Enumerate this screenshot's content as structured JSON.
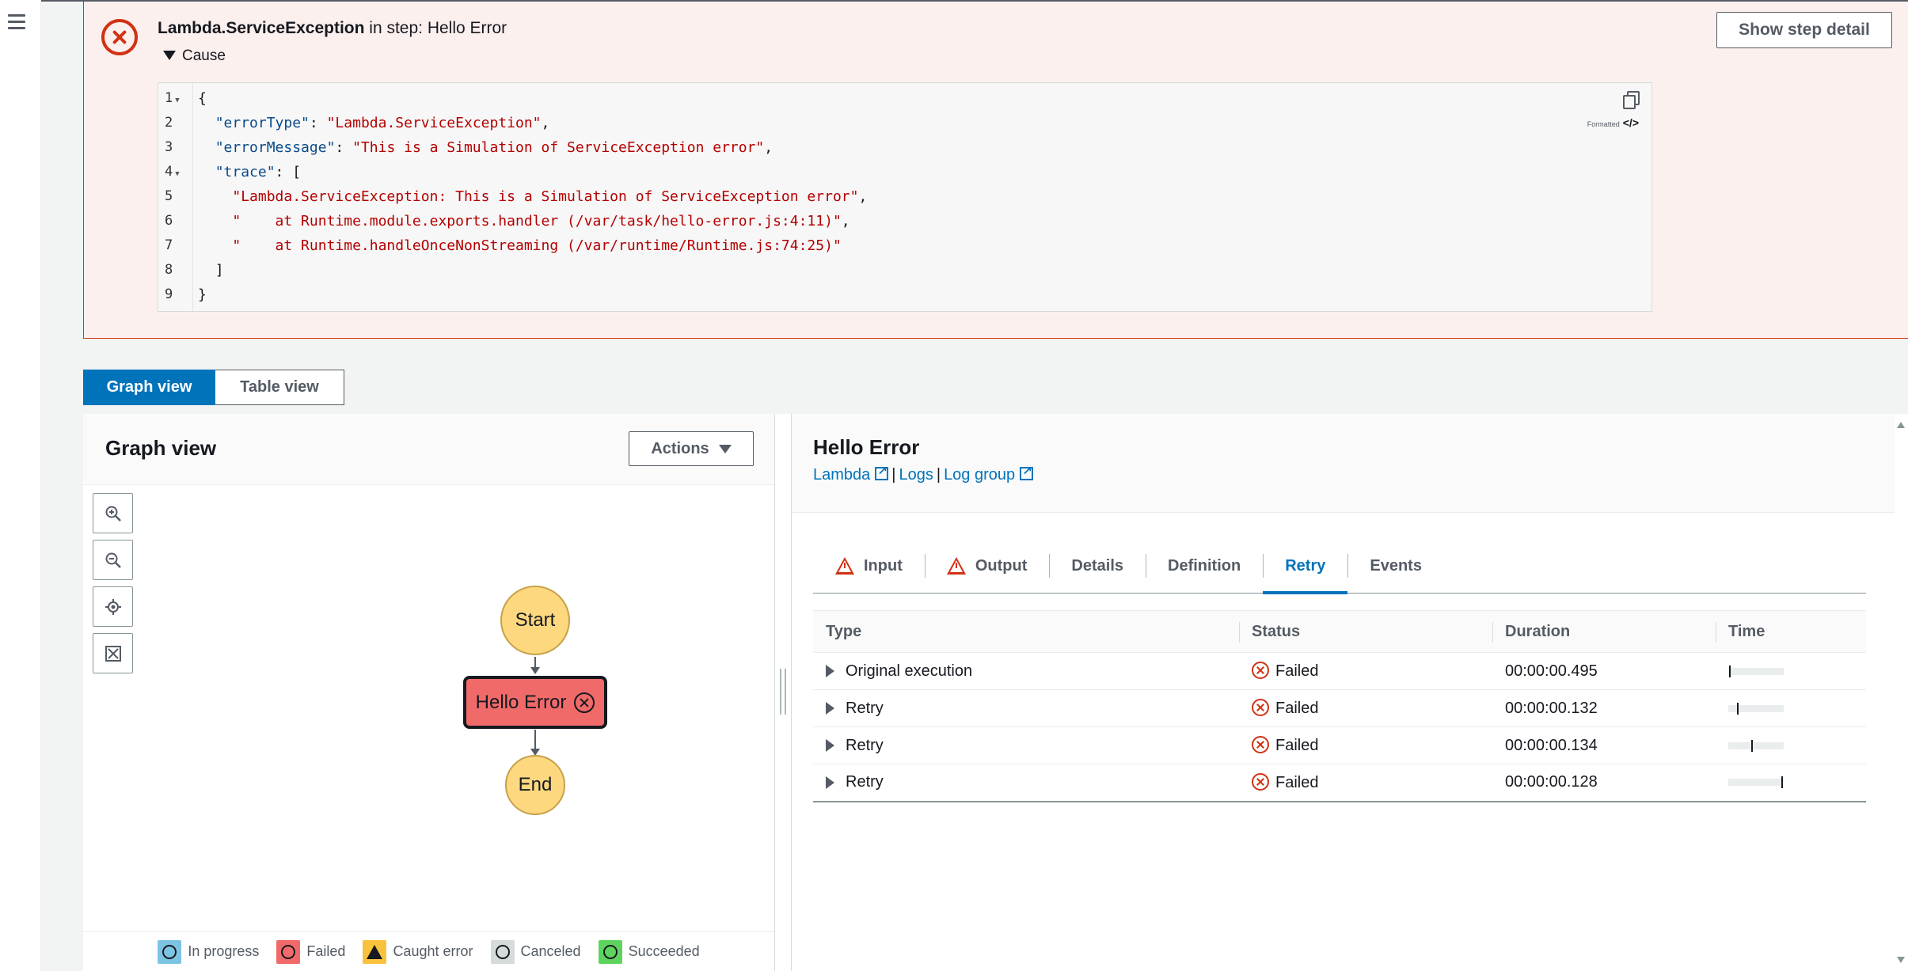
{
  "error": {
    "type": "Lambda.ServiceException",
    "suffix": " in step: Hello Error",
    "cause_label": "Cause",
    "show_step_button": "Show step detail",
    "format_label": "Formatted",
    "code_lines": [
      {
        "n": "1",
        "fold": true
      },
      {
        "n": "2"
      },
      {
        "n": "3"
      },
      {
        "n": "4",
        "fold": true
      },
      {
        "n": "5"
      },
      {
        "n": "6"
      },
      {
        "n": "7"
      },
      {
        "n": "8"
      },
      {
        "n": "9"
      }
    ],
    "json": {
      "open": "{",
      "k_type": "\"errorType\"",
      "v_type": "\"Lambda.ServiceException\"",
      "k_msg": "\"errorMessage\"",
      "v_msg": "\"This is a Simulation of ServiceException error\"",
      "k_trace": "\"trace\"",
      "t1": "\"Lambda.ServiceException: This is a Simulation of ServiceException error\"",
      "t2": "\"    at Runtime.module.exports.handler (/var/task/hello-error.js:4:11)\"",
      "t3": "\"    at Runtime.handleOnceNonStreaming (/var/runtime/Runtime.js:74:25)\"",
      "close_arr": "]",
      "close": "}"
    }
  },
  "view_toggle": {
    "graph": "Graph view",
    "table": "Table view",
    "selected": "graph"
  },
  "graph": {
    "title": "Graph view",
    "actions": "Actions",
    "nodes": {
      "start": "Start",
      "failed": "Hello Error",
      "end": "End"
    },
    "legend": [
      {
        "label": "In progress",
        "color": "#7dc4e4",
        "icon": "clock-icon"
      },
      {
        "label": "Failed",
        "color": "#f06a6a",
        "icon": "x-circle-icon"
      },
      {
        "label": "Caught error",
        "color": "#f9c23c",
        "icon": "warning-icon"
      },
      {
        "label": "Canceled",
        "color": "#d5dbdb",
        "icon": "minus-circle-icon"
      },
      {
        "label": "Succeeded",
        "color": "#5ed45e",
        "icon": "check-circle-icon"
      }
    ]
  },
  "detail": {
    "title": "Hello Error",
    "links": [
      "Lambda",
      "Logs",
      "Log group"
    ],
    "tabs": [
      "Input",
      "Output",
      "Details",
      "Definition",
      "Retry",
      "Events"
    ],
    "active_tab": "Retry",
    "table": {
      "headers": [
        "Type",
        "Status",
        "Duration",
        "Time"
      ],
      "rows": [
        {
          "type": "Original execution",
          "status": "Failed",
          "duration": "00:00:00.495",
          "time_marker": 0.02
        },
        {
          "type": "Retry",
          "status": "Failed",
          "duration": "00:00:00.132",
          "time_marker": 0.16
        },
        {
          "type": "Retry",
          "status": "Failed",
          "duration": "00:00:00.134",
          "time_marker": 0.42
        },
        {
          "type": "Retry",
          "status": "Failed",
          "duration": "00:00:00.128",
          "time_marker": 0.98
        }
      ]
    }
  },
  "colors": {
    "accent": "#0073bb",
    "error": "#d13212",
    "error_bg": "#fcf0ef"
  }
}
